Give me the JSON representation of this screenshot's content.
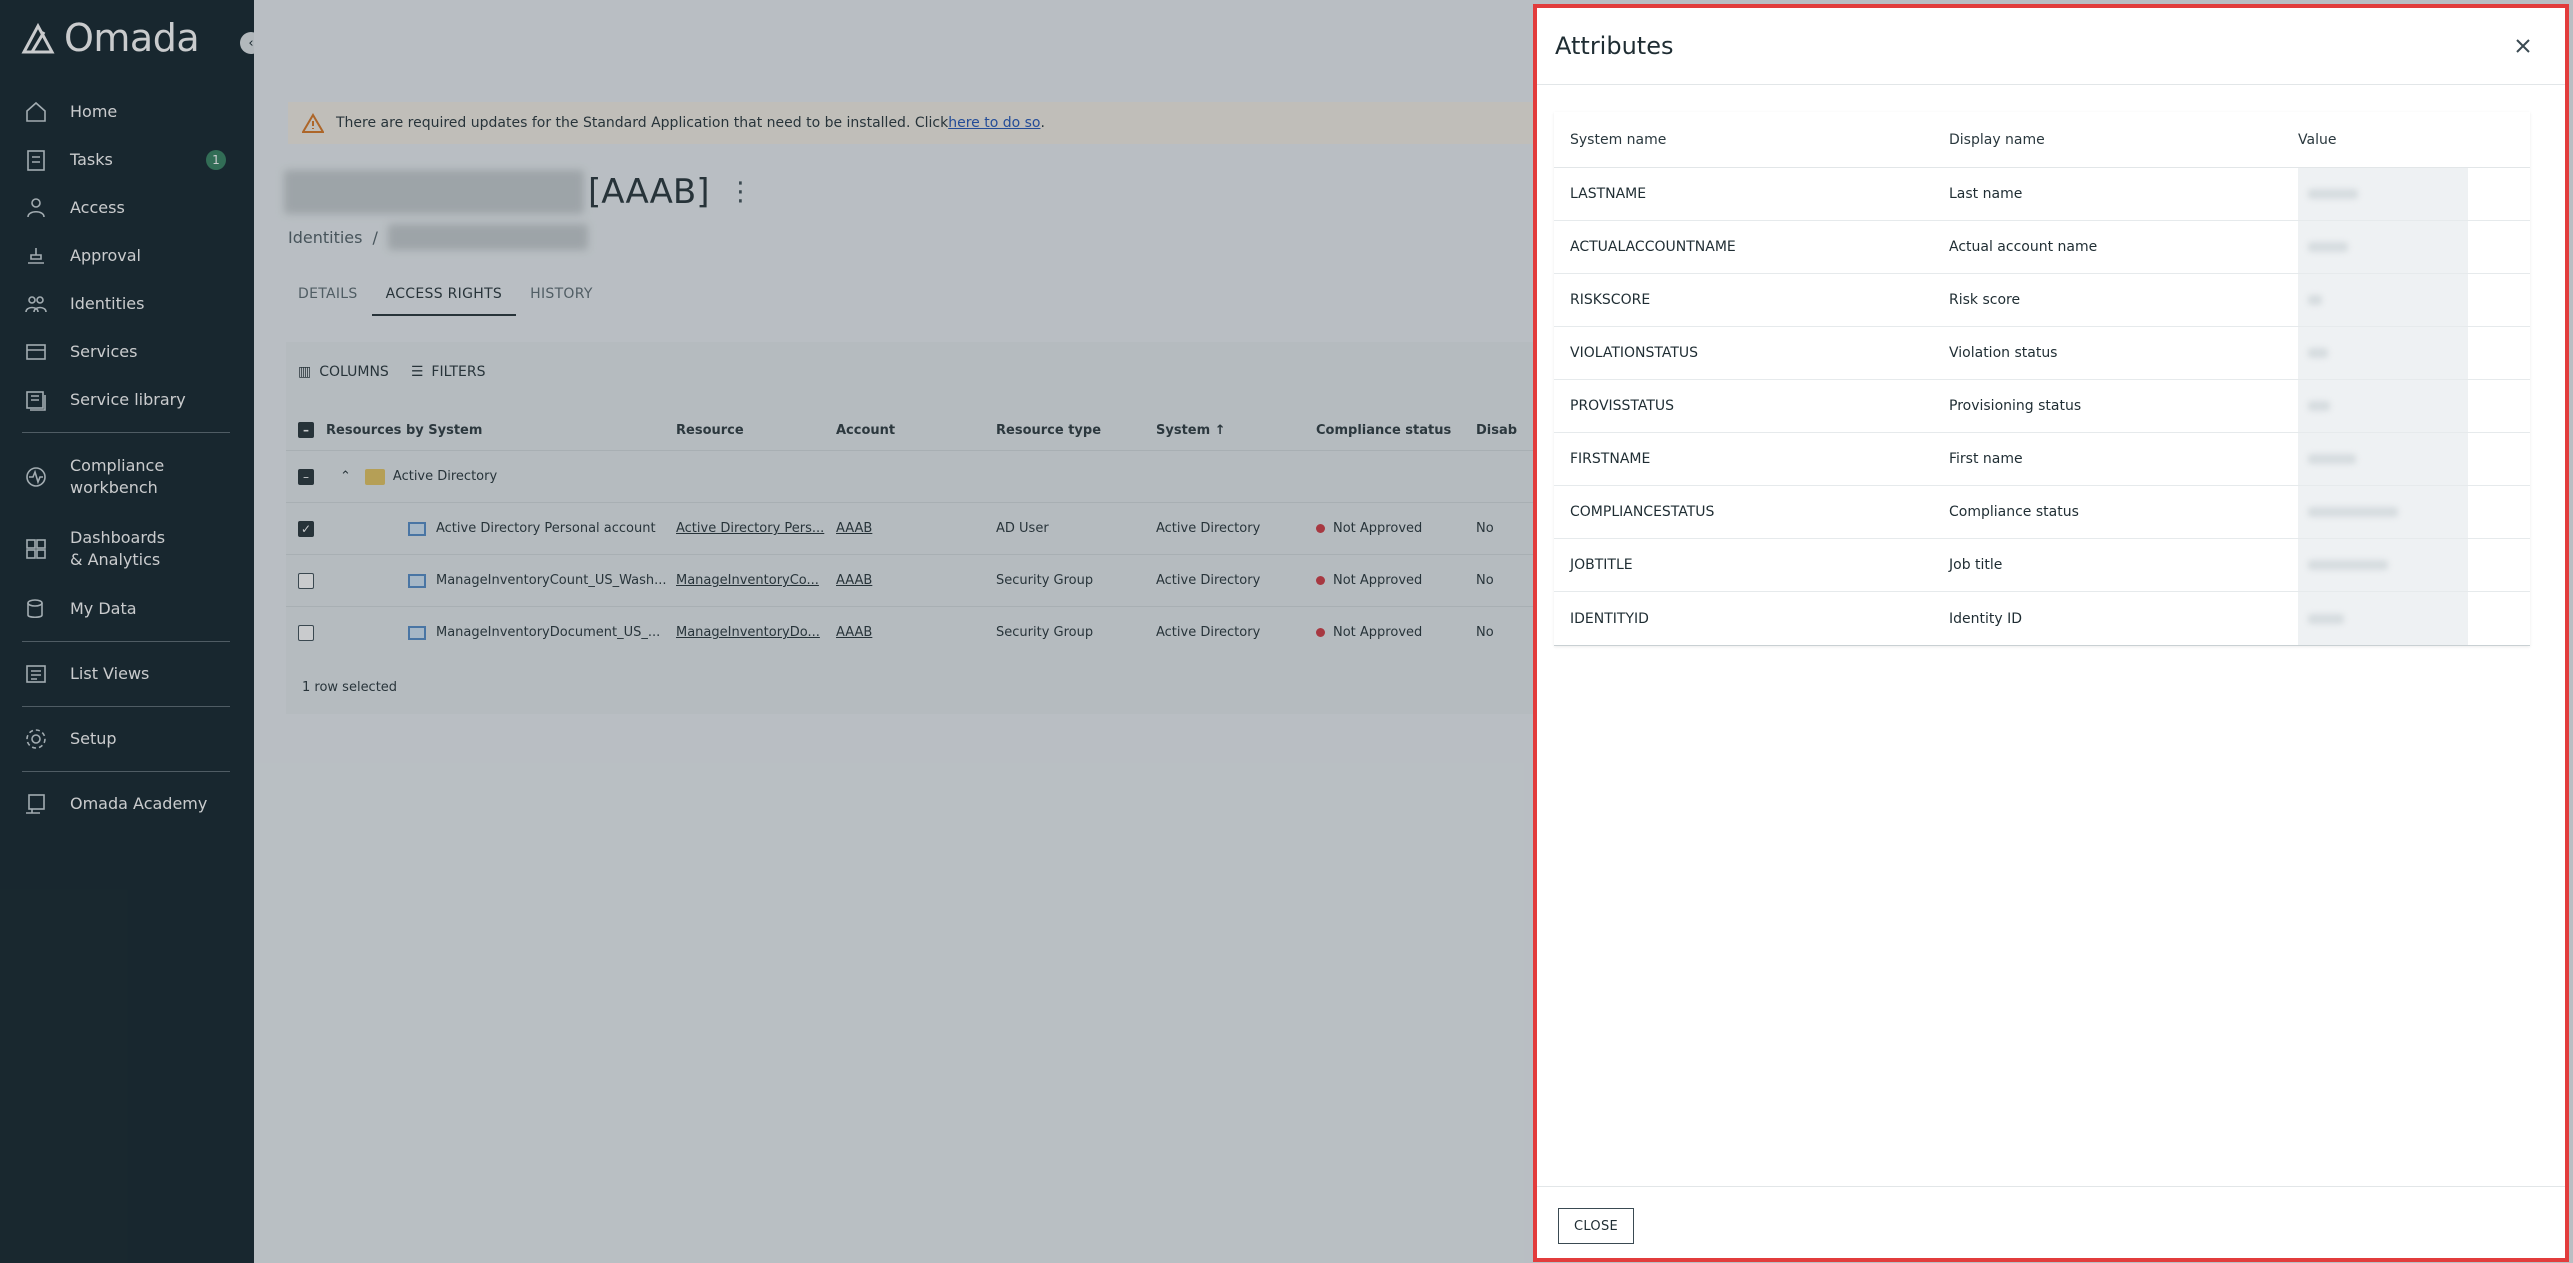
{
  "app": {
    "name": "Omada"
  },
  "sidebar": {
    "collapse_icon": "chevron-left-icon",
    "items": [
      {
        "label": "Home",
        "icon": "home-icon"
      },
      {
        "label": "Tasks",
        "icon": "tasks-icon",
        "badge": "1"
      },
      {
        "label": "Access",
        "icon": "access-icon"
      },
      {
        "label": "Approval",
        "icon": "approval-icon"
      },
      {
        "label": "Identities",
        "icon": "identities-icon"
      },
      {
        "label": "Services",
        "icon": "services-icon"
      },
      {
        "label": "Service library",
        "icon": "service-library-icon"
      },
      {
        "label": "Compliance workbench",
        "icon": "compliance-icon"
      },
      {
        "label": "Dashboards & Analytics",
        "icon": "dashboards-icon"
      },
      {
        "label": "My Data",
        "icon": "my-data-icon"
      },
      {
        "label": "List Views",
        "icon": "list-views-icon"
      },
      {
        "label": "Setup",
        "icon": "gear-icon"
      },
      {
        "label": "Omada Academy",
        "icon": "academy-icon"
      }
    ]
  },
  "main": {
    "banner": {
      "text": "There are required updates for the Standard Application that need to be installed. Click ",
      "link": "here to do so",
      "suffix": "."
    },
    "title_code": "[AAAB]",
    "breadcrumb": {
      "root": "Identities",
      "separator": "/"
    },
    "tabs": [
      "DETAILS",
      "ACCESS RIGHTS",
      "HISTORY"
    ],
    "active_tab": "ACCESS RIGHTS",
    "toolbar": {
      "columns": "COLUMNS",
      "filters": "FILTERS"
    },
    "grid": {
      "columns": [
        "Resources by System",
        "Resource",
        "Account",
        "Resource type",
        "System",
        "Compliance status",
        "Disab"
      ],
      "group": "Active Directory",
      "rows": [
        {
          "name": "Active Directory Personal account",
          "resource": "Active Directory Pers...",
          "account": "AAAB",
          "type": "AD User",
          "system": "Active Directory",
          "compliance": "Not Approved",
          "disabled": "No",
          "checked": true
        },
        {
          "name": "ManageInventoryCount_US_Wash...",
          "resource": "ManageInventoryCo...",
          "account": "AAAB",
          "type": "Security Group",
          "system": "Active Directory",
          "compliance": "Not Approved",
          "disabled": "No",
          "checked": false
        },
        {
          "name": "ManageInventoryDocument_US_...",
          "resource": "ManageInventoryDo...",
          "account": "AAAB",
          "type": "Security Group",
          "system": "Active Directory",
          "compliance": "Not Approved",
          "disabled": "No",
          "checked": false
        }
      ],
      "footer": "1 row selected"
    }
  },
  "dialog": {
    "title": "Attributes",
    "close_icon": "close-icon",
    "headers": {
      "system_name": "System name",
      "display_name": "Display name",
      "value": "Value"
    },
    "rows": [
      {
        "system_name": "LASTNAME",
        "display_name": "Last name"
      },
      {
        "system_name": "ACTUALACCOUNTNAME",
        "display_name": "Actual account name"
      },
      {
        "system_name": "RISKSCORE",
        "display_name": "Risk score"
      },
      {
        "system_name": "VIOLATIONSTATUS",
        "display_name": "Violation status"
      },
      {
        "system_name": "PROVISSTATUS",
        "display_name": "Provisioning status"
      },
      {
        "system_name": "FIRSTNAME",
        "display_name": "First name"
      },
      {
        "system_name": "COMPLIANCESTATUS",
        "display_name": "Compliance status"
      },
      {
        "system_name": "JOBTITLE",
        "display_name": "Job title"
      },
      {
        "system_name": "IDENTITYID",
        "display_name": "Identity ID"
      }
    ],
    "close_label": "CLOSE"
  },
  "colors": {
    "sidebar_bg": "#0b1c24",
    "accent_red": "#e23c3c",
    "status_red": "#d0343d",
    "badge_green": "#2e7d5b"
  }
}
